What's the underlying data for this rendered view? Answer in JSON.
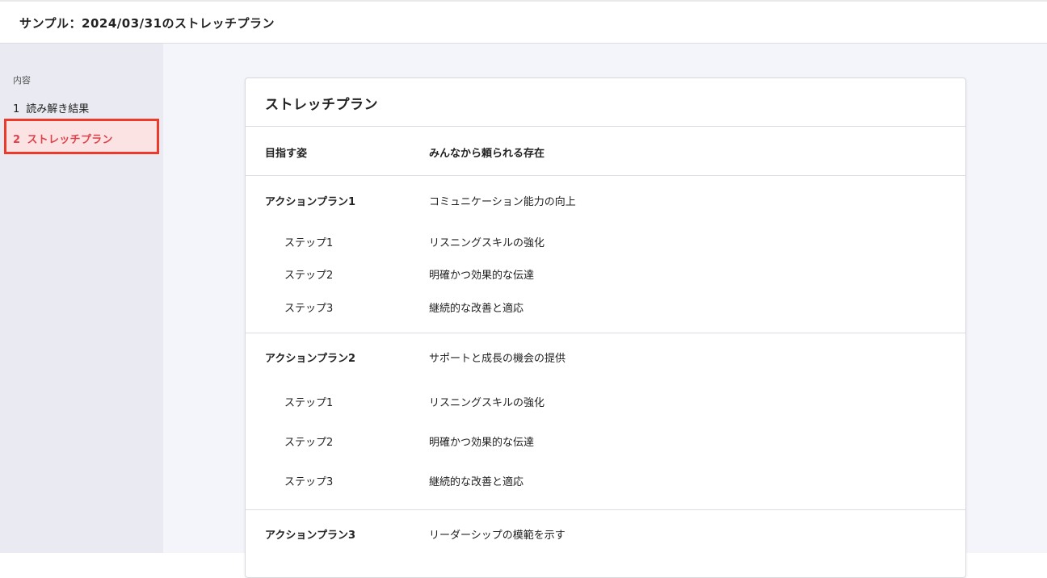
{
  "header": {
    "title": "サンプル：2024/03/31のストレッチプラン"
  },
  "sidebar": {
    "heading": "内容",
    "items": [
      {
        "num": "1",
        "label": "読み解き結果"
      },
      {
        "num": "2",
        "label": "ストレッチプラン"
      }
    ]
  },
  "card": {
    "title": "ストレッチプラン",
    "goal": {
      "label": "目指す姿",
      "value": "みんなから頼られる存在"
    },
    "actions": [
      {
        "label": "アクションプラン1",
        "value": "コミュニケーション能力の向上",
        "steps": [
          {
            "label": "ステップ1",
            "value": "リスニングスキルの強化"
          },
          {
            "label": "ステップ2",
            "value": "明確かつ効果的な伝達"
          },
          {
            "label": "ステップ3",
            "value": "継続的な改善と適応"
          }
        ]
      },
      {
        "label": "アクションプラン2",
        "value": "サポートと成長の機会の提供",
        "steps": [
          {
            "label": "ステップ1",
            "value": "リスニングスキルの強化"
          },
          {
            "label": "ステップ2",
            "value": "明確かつ効果的な伝達"
          },
          {
            "label": "ステップ3",
            "value": "継続的な改善と適応"
          }
        ]
      },
      {
        "label": "アクションプラン3",
        "value": "リーダーシップの模範を示す"
      }
    ]
  },
  "colors": {
    "highlight_border": "#ee3a2a",
    "highlight_bg": "#fbe3e4",
    "active_text": "#e0414a",
    "sidebar_bg": "#eaebf2",
    "main_bg": "#f4f5fa"
  }
}
